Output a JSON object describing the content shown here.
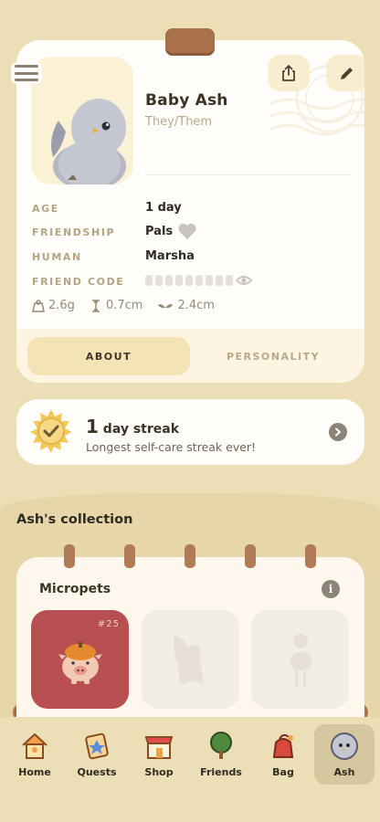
{
  "profile": {
    "name": "Baby Ash",
    "pronouns": "They/Them",
    "rows": [
      {
        "label": "AGE",
        "value": "1 day"
      },
      {
        "label": "FRIENDSHIP",
        "value": "Pals"
      },
      {
        "label": "HUMAN",
        "value": "Marsha"
      },
      {
        "label": "FRIEND CODE",
        "value": ""
      }
    ],
    "stats": {
      "weight": "2.6g",
      "height": "0.7cm",
      "wingspan": "2.4cm"
    },
    "tabs": [
      "ABOUT",
      "PERSONALITY"
    ],
    "active_tab": "ABOUT"
  },
  "streak": {
    "count": "1",
    "label": "day streak",
    "subtitle": "Longest self-care streak ever!"
  },
  "collection": {
    "section_title": "Ash's collection",
    "card_title": "Micropets",
    "items": [
      {
        "number": "#25",
        "unlocked": true
      },
      {
        "unlocked": false
      },
      {
        "unlocked": false
      }
    ]
  },
  "nav": {
    "items": [
      "Home",
      "Quests",
      "Shop",
      "Friends",
      "Bag",
      "Ash"
    ],
    "active": "Ash"
  },
  "icons": [
    "menu-icon",
    "share-icon",
    "pencil-icon",
    "heart-icon",
    "eye-icon",
    "scale-icon",
    "height-icon",
    "wingspan-icon",
    "sun-check-icon",
    "chevron-right-icon",
    "info-icon"
  ],
  "colors": {
    "background": "#eddfb5",
    "card": "#fffefa",
    "accent_tile": "#b84f50",
    "clip": "#a9714a"
  }
}
